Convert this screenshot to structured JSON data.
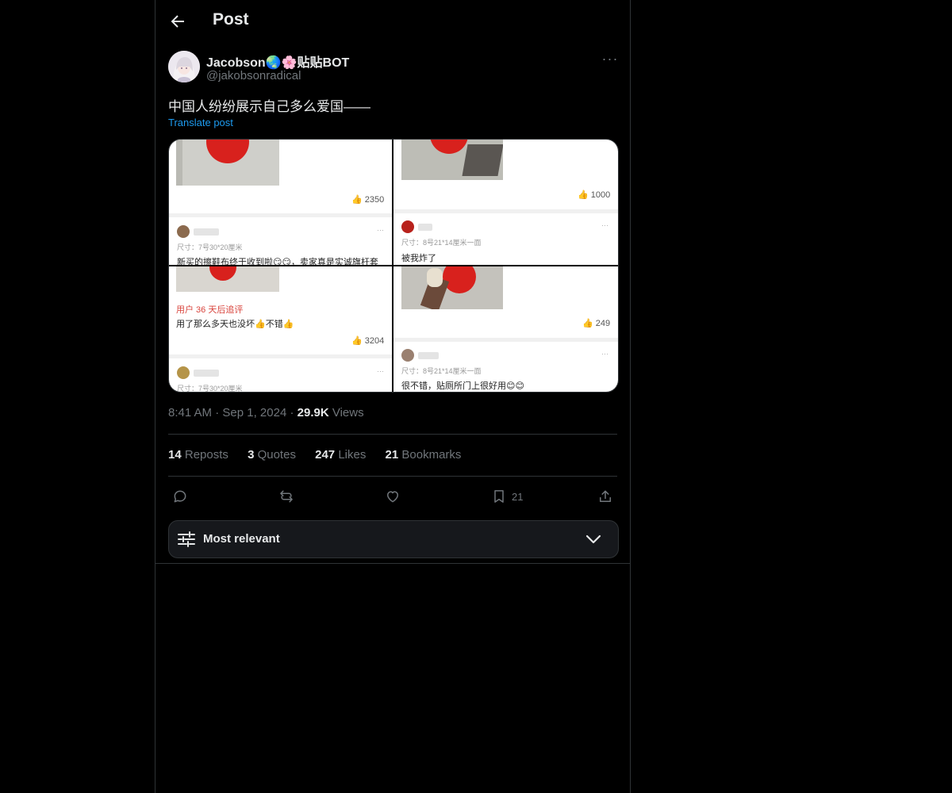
{
  "header": {
    "title": "Post"
  },
  "post": {
    "author": {
      "display_name": "Jacobson🌏🌸贴贴BOT",
      "handle": "@jakobsonradical"
    },
    "text": "中国人纷纷展示自己多么爱国——",
    "translate_label": "Translate post",
    "media": {
      "panels": [
        {
          "likes": "2350",
          "size": "尺寸：7号30*20厘米",
          "review": "新买的擦鞋布终于收到啦😏😏，卖家真是实诚旗杆套"
        },
        {
          "likes": "1000",
          "size": "尺寸：8号21*14厘米一面",
          "review": "被我炸了"
        },
        {
          "followup": "用户 36 天后追评",
          "review": "用了那么多天也没坏👍不错👍",
          "likes": "3204",
          "size": "尺寸：7号30*20厘米"
        },
        {
          "likes": "249",
          "size": "尺寸：8号21*14厘米一面",
          "review": "很不错，贴厕所门上很好用😊😊"
        }
      ]
    },
    "time": "8:41 AM",
    "date": "Sep 1, 2024",
    "views_count": "29.9K",
    "views_label": "Views",
    "stats": {
      "reposts": {
        "count": "14",
        "label": "Reposts"
      },
      "quotes": {
        "count": "3",
        "label": "Quotes"
      },
      "likes": {
        "count": "247",
        "label": "Likes"
      },
      "bookmarks": {
        "count": "21",
        "label": "Bookmarks"
      }
    },
    "actions": {
      "bookmark_count": "21"
    }
  },
  "sort": {
    "label": "Most relevant"
  },
  "colors": {
    "accent": "#1d9bf0",
    "background": "#000000",
    "muted": "#71767b",
    "border": "#2f3336"
  },
  "icons": [
    "back-arrow-icon",
    "more-icon",
    "reply-icon",
    "repost-icon",
    "like-icon",
    "bookmark-icon",
    "share-icon",
    "sliders-icon",
    "chevron-down-icon"
  ]
}
